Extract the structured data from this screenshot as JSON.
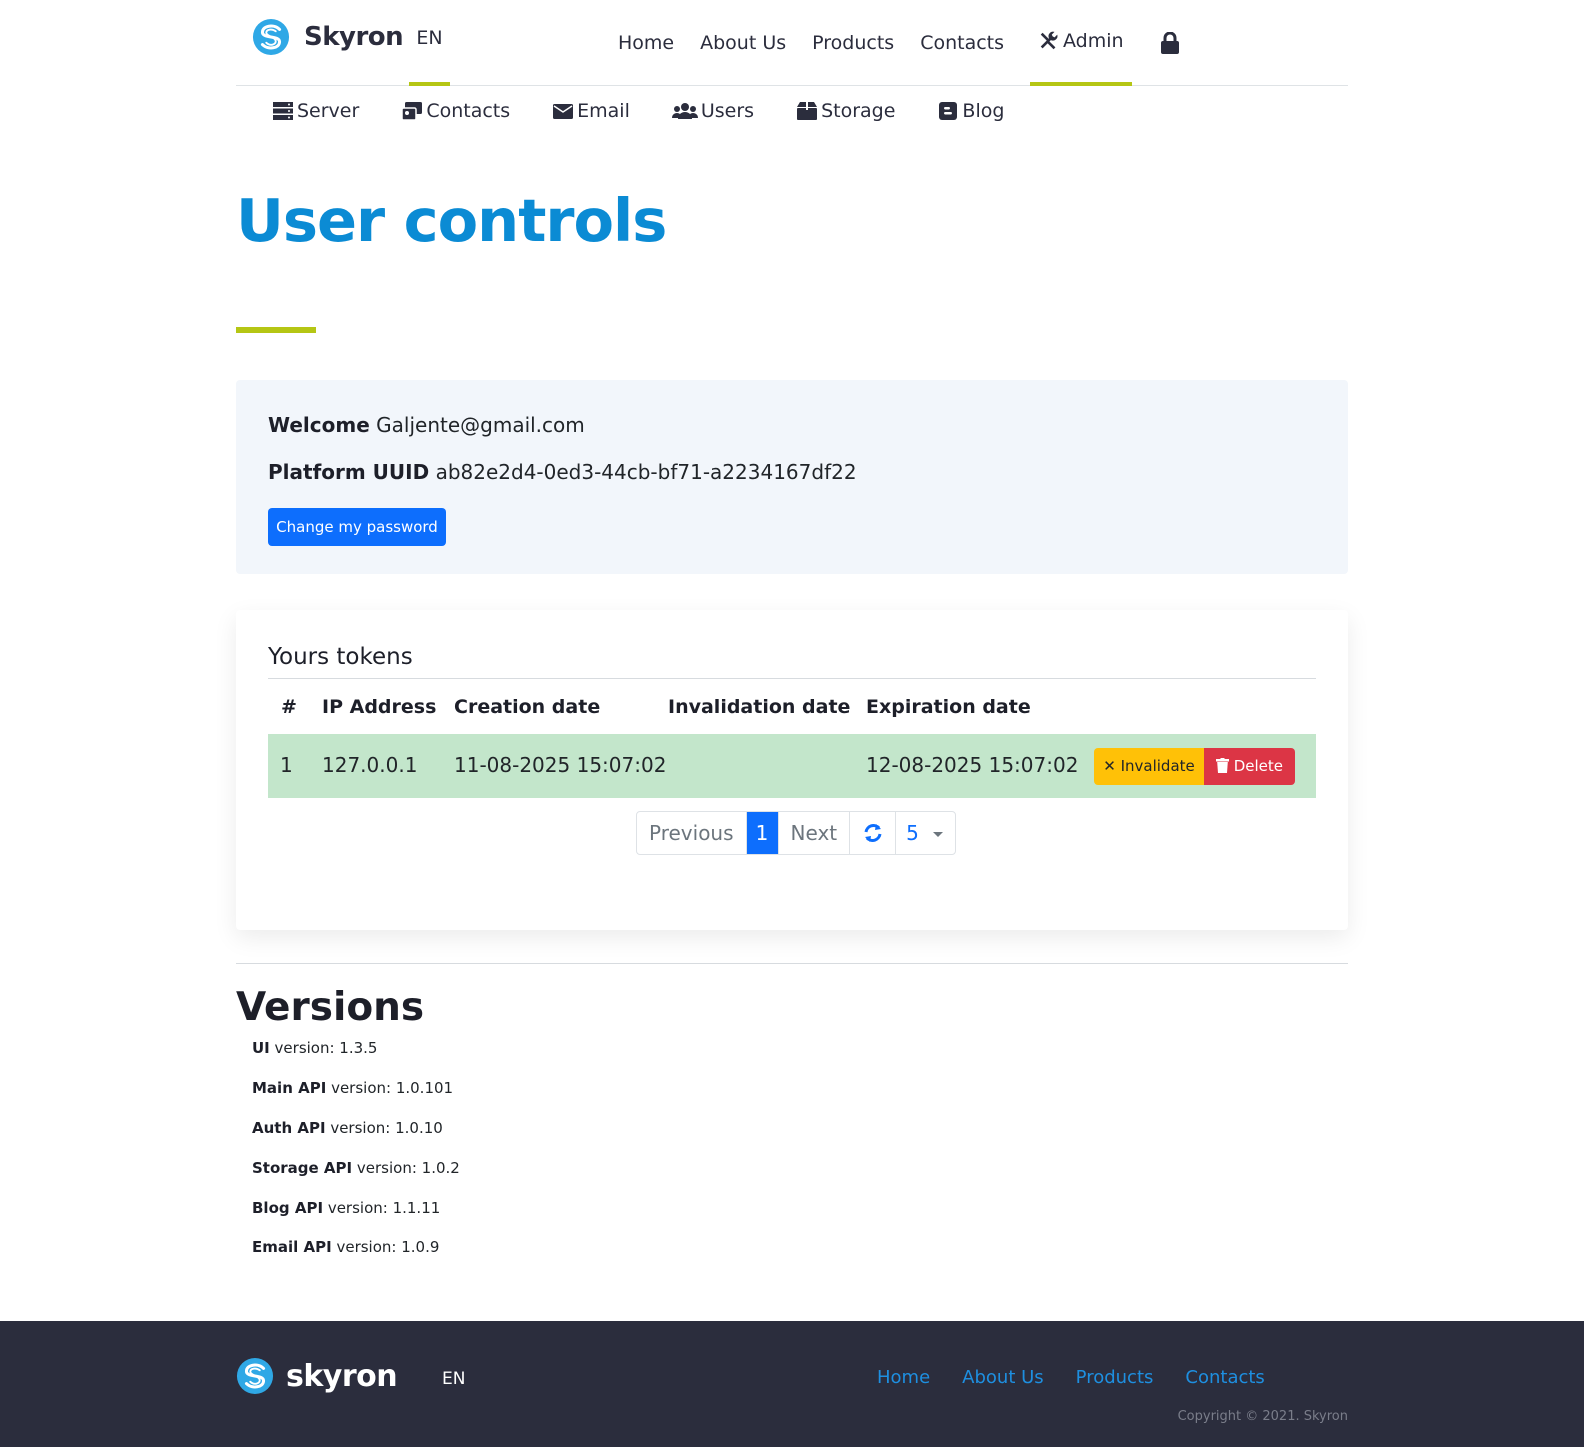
{
  "header": {
    "brand": "Skyron",
    "language": "EN",
    "nav": [
      {
        "label": "Home"
      },
      {
        "label": "About Us"
      },
      {
        "label": "Products"
      },
      {
        "label": "Contacts"
      },
      {
        "label": "Admin",
        "icon": "tools-icon"
      }
    ],
    "lock_icon": "lock-icon"
  },
  "admin_nav": [
    {
      "label": "Server",
      "icon": "server-icon"
    },
    {
      "label": "Contacts",
      "icon": "address-card-icon"
    },
    {
      "label": "Email",
      "icon": "envelope-icon"
    },
    {
      "label": "Users",
      "icon": "users-icon"
    },
    {
      "label": "Storage",
      "icon": "box-icon"
    },
    {
      "label": "Blog",
      "icon": "blogger-icon"
    }
  ],
  "page": {
    "title": "User controls"
  },
  "welcome": {
    "welcome_label": "Welcome",
    "email": "Galjente@gmail.com",
    "uuid_label": "Platform UUID",
    "uuid": "ab82e2d4-0ed3-44cb-bf71-a2234167df22",
    "change_password_label": "Change my password"
  },
  "tokens": {
    "title": "Yours tokens",
    "columns": [
      "#",
      "IP Address",
      "Creation date",
      "Invalidation date",
      "Expiration date"
    ],
    "rows": [
      {
        "index": "1",
        "ip": "127.0.0.1",
        "created": "11-08-2025 15:07:02",
        "invalidated": "",
        "expires": "12-08-2025 15:07:02",
        "invalidate_label": "Invalidate",
        "delete_label": "Delete"
      }
    ],
    "pagination": {
      "previous": "Previous",
      "current_page": "1",
      "next": "Next",
      "page_size": "5"
    }
  },
  "versions": {
    "title": "Versions",
    "items": [
      {
        "name": "UI",
        "text": "version: 1.3.5"
      },
      {
        "name": "Main API",
        "text": "version: 1.0.101"
      },
      {
        "name": "Auth API",
        "text": "version: 1.0.10"
      },
      {
        "name": "Storage API",
        "text": "version: 1.0.2"
      },
      {
        "name": "Blog API",
        "text": "version: 1.1.11"
      },
      {
        "name": "Email API",
        "text": "version: 1.0.9"
      }
    ]
  },
  "footer": {
    "brand": "skyron",
    "language": "EN",
    "links": [
      {
        "label": "Home"
      },
      {
        "label": "About Us"
      },
      {
        "label": "Products"
      },
      {
        "label": "Contacts"
      }
    ],
    "copyright": "Copyright © 2021. Skyron"
  },
  "colors": {
    "accent": "#b5c614",
    "title_blue": "#0b8bd4",
    "primary": "#0d6efd",
    "warning": "#ffc107",
    "danger": "#dc3545",
    "row_success": "#c3e6cb",
    "footer_bg": "#2b2d3d"
  }
}
